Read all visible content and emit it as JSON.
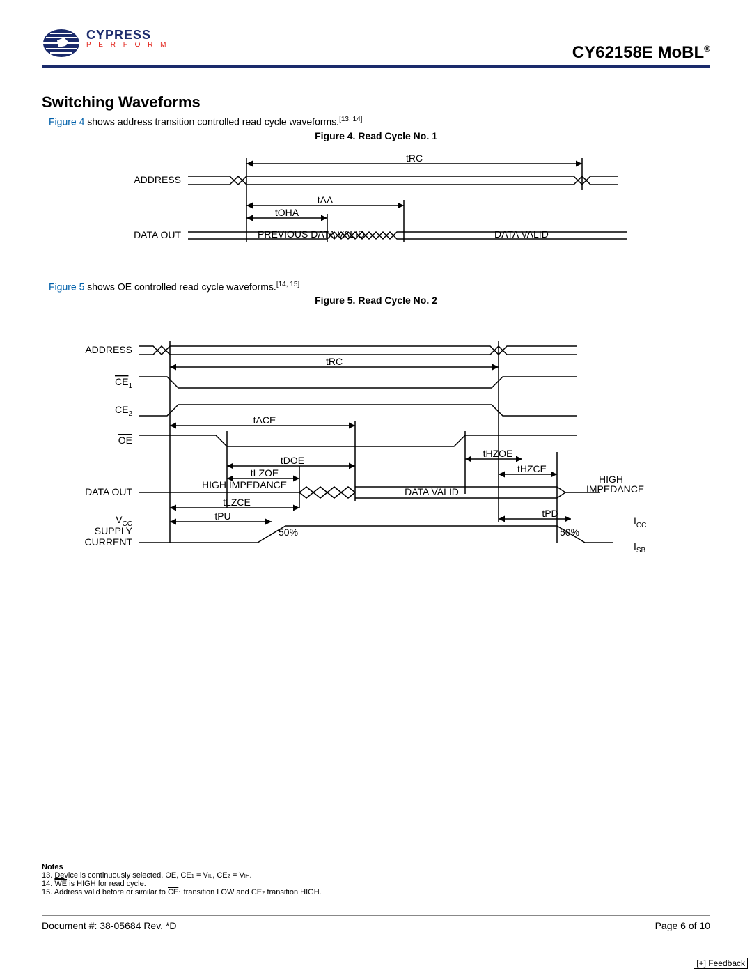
{
  "header": {
    "logo_name": "CYPRESS",
    "logo_tag": "P E R F O R M",
    "part_number": "CY62158E MoBL",
    "reg_mark": "®"
  },
  "section_title": "Switching Waveforms",
  "intro1_link": "Figure 4",
  "intro1_text": " shows address transition controlled read cycle waveforms.",
  "intro1_refs": "[13, 14]",
  "fig4_caption": "Figure 4.  Read Cycle No. 1",
  "fig4": {
    "sig_address": "ADDRESS",
    "sig_dataout": "DATA OUT",
    "t_rc": "tRC",
    "t_aa": "tAA",
    "t_oha": "tOHA",
    "prev_valid": "PREVIOUS DATA VALID",
    "data_valid": "DATA VALID"
  },
  "intro2_link": "Figure 5",
  "intro2_text_a": " shows ",
  "intro2_oe": "OE",
  "intro2_text_b": " controlled read cycle waveforms.",
  "intro2_refs": "[14, 15]",
  "fig5_caption": "Figure 5.  Read Cycle No. 2",
  "fig5": {
    "sig_address": "ADDRESS",
    "sig_ce1": "CE",
    "sig_ce1_sub": "1",
    "sig_ce2": "CE",
    "sig_ce2_sub": "2",
    "sig_oe": "OE",
    "sig_dataout": "DATA  OUT",
    "sig_vcc": "V",
    "sig_vcc_sub": "CC",
    "sig_supply": "SUPPLY",
    "sig_current": "CURRENT",
    "t_rc": "tRC",
    "t_ace": "tACE",
    "t_doe": "tDOE",
    "t_lzoe": "tLZOE",
    "t_lzce": "tLZCE",
    "t_pu": "tPU",
    "t_hzoe": "tHZOE",
    "t_hzce": "tHZCE",
    "t_pd": "tPD",
    "hi_imp": "HIGH IMPEDANCE",
    "hi_imp2": "HIGH",
    "hi_imp2b": "IMPEDANCE",
    "data_valid": "DATA VALID",
    "pct50a": "50%",
    "pct50b": "50%",
    "icc": "I",
    "icc_sub": "CC",
    "isb": "I",
    "isb_sub": "SB"
  },
  "notes": {
    "header": "Notes",
    "n13a": "13. ",
    "n13_de": "De",
    "n13b": "vice is continuously selected. ",
    "n13_oe": "OE",
    "n13c": ", ",
    "n13_ce1": "CE",
    "n13_ce1_sub": "1",
    "n13d": " = V",
    "n13_vil_sub": "IL",
    "n13e": ", CE",
    "n13_ce2_sub": "2",
    "n13f": " = V",
    "n13_vih_sub": "IH",
    "n13g": ".",
    "n14a": "14. ",
    "n14_we": "WE",
    "n14b": " is HIGH for read cycle.",
    "n15a": "15. Address valid before or similar to ",
    "n15_ce1": "CE",
    "n15_ce1_sub": "1",
    "n15b": " transition LOW and CE",
    "n15_ce2_sub": "2",
    "n15c": " transition HIGH."
  },
  "footer": {
    "doc": "Document #: 38-05684 Rev. *D",
    "page": "Page 6 of 10"
  },
  "feedback": "[+] Feedback"
}
